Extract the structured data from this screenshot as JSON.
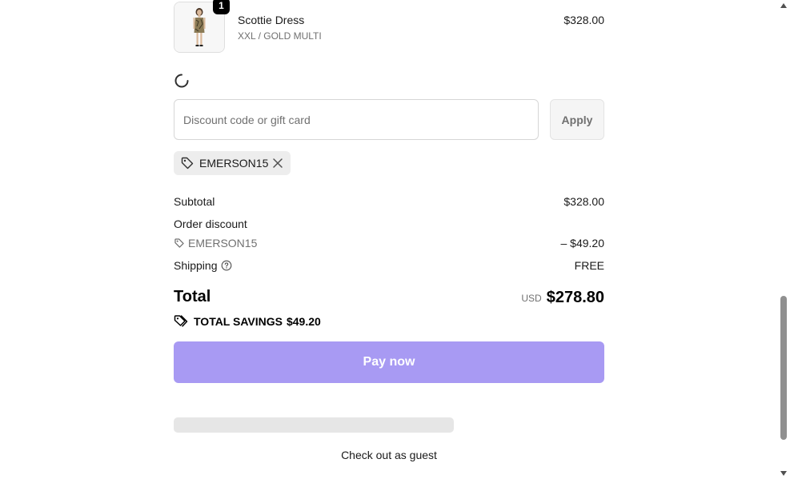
{
  "line_item": {
    "name": "Scottie Dress",
    "variant": "XXL / GOLD MULTI",
    "price": "$328.00",
    "quantity": "1"
  },
  "discount": {
    "placeholder": "Discount code or gift card",
    "value": "",
    "apply_label": "Apply",
    "applied_code": "EMERSON15"
  },
  "summary": {
    "subtotal_label": "Subtotal",
    "subtotal_value": "$328.00",
    "order_discount_label": "Order discount",
    "discount_code": "EMERSON15",
    "discount_value": "– $49.20",
    "shipping_label": "Shipping",
    "shipping_value": "FREE",
    "total_label": "Total",
    "currency": "USD",
    "total_value": "$278.80",
    "savings_label": "TOTAL SAVINGS",
    "savings_value": "$49.20"
  },
  "actions": {
    "pay_label": "Pay now",
    "guest_label": "Check out as guest"
  },
  "colors": {
    "pay_button": "#a89af3",
    "tag_background": "#ededed",
    "muted_text": "#707070"
  },
  "icons": {
    "loading": "spinner-icon",
    "tag": "tag-icon",
    "remove": "close-icon",
    "help": "question-circle-icon",
    "savings": "tags-icon"
  }
}
